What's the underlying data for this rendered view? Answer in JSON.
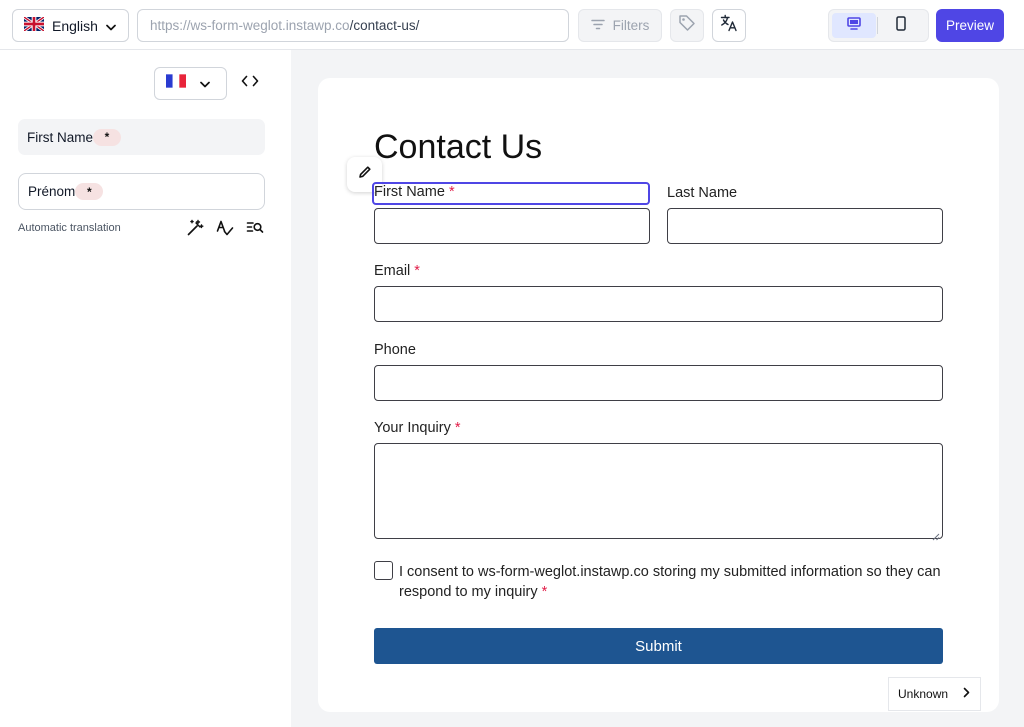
{
  "topbar": {
    "language": {
      "label": "English",
      "flag": "uk-flag-icon"
    },
    "url": {
      "domain": "https://ws-form-weglot.instawp.co",
      "path": "/contact-us/"
    },
    "filters_label": "Filters",
    "preview_label": "Preview",
    "device": {
      "active": "desktop"
    }
  },
  "left_panel": {
    "target_language": {
      "flag": "france-flag-icon"
    },
    "source_text": "First Name",
    "source_chip": "*",
    "translation_text": "Prénom",
    "translation_chip": "*",
    "automatic_label": "Automatic translation"
  },
  "form": {
    "title": "Contact Us",
    "fields": {
      "first_name": {
        "label": "First Name",
        "required": "*"
      },
      "last_name": {
        "label": "Last Name"
      },
      "email": {
        "label": "Email",
        "required": "*"
      },
      "phone": {
        "label": "Phone"
      },
      "inquiry": {
        "label": "Your Inquiry",
        "required": "*"
      }
    },
    "consent": {
      "text": "I consent to ws-form-weglot.instawp.co storing my submitted information so they can respond to my inquiry",
      "required": "*"
    },
    "submit_label": "Submit"
  },
  "status": {
    "unknown_label": "Unknown"
  },
  "colors": {
    "accent": "#4f46e5",
    "submit": "#1e5591",
    "required": "#e11d48"
  }
}
